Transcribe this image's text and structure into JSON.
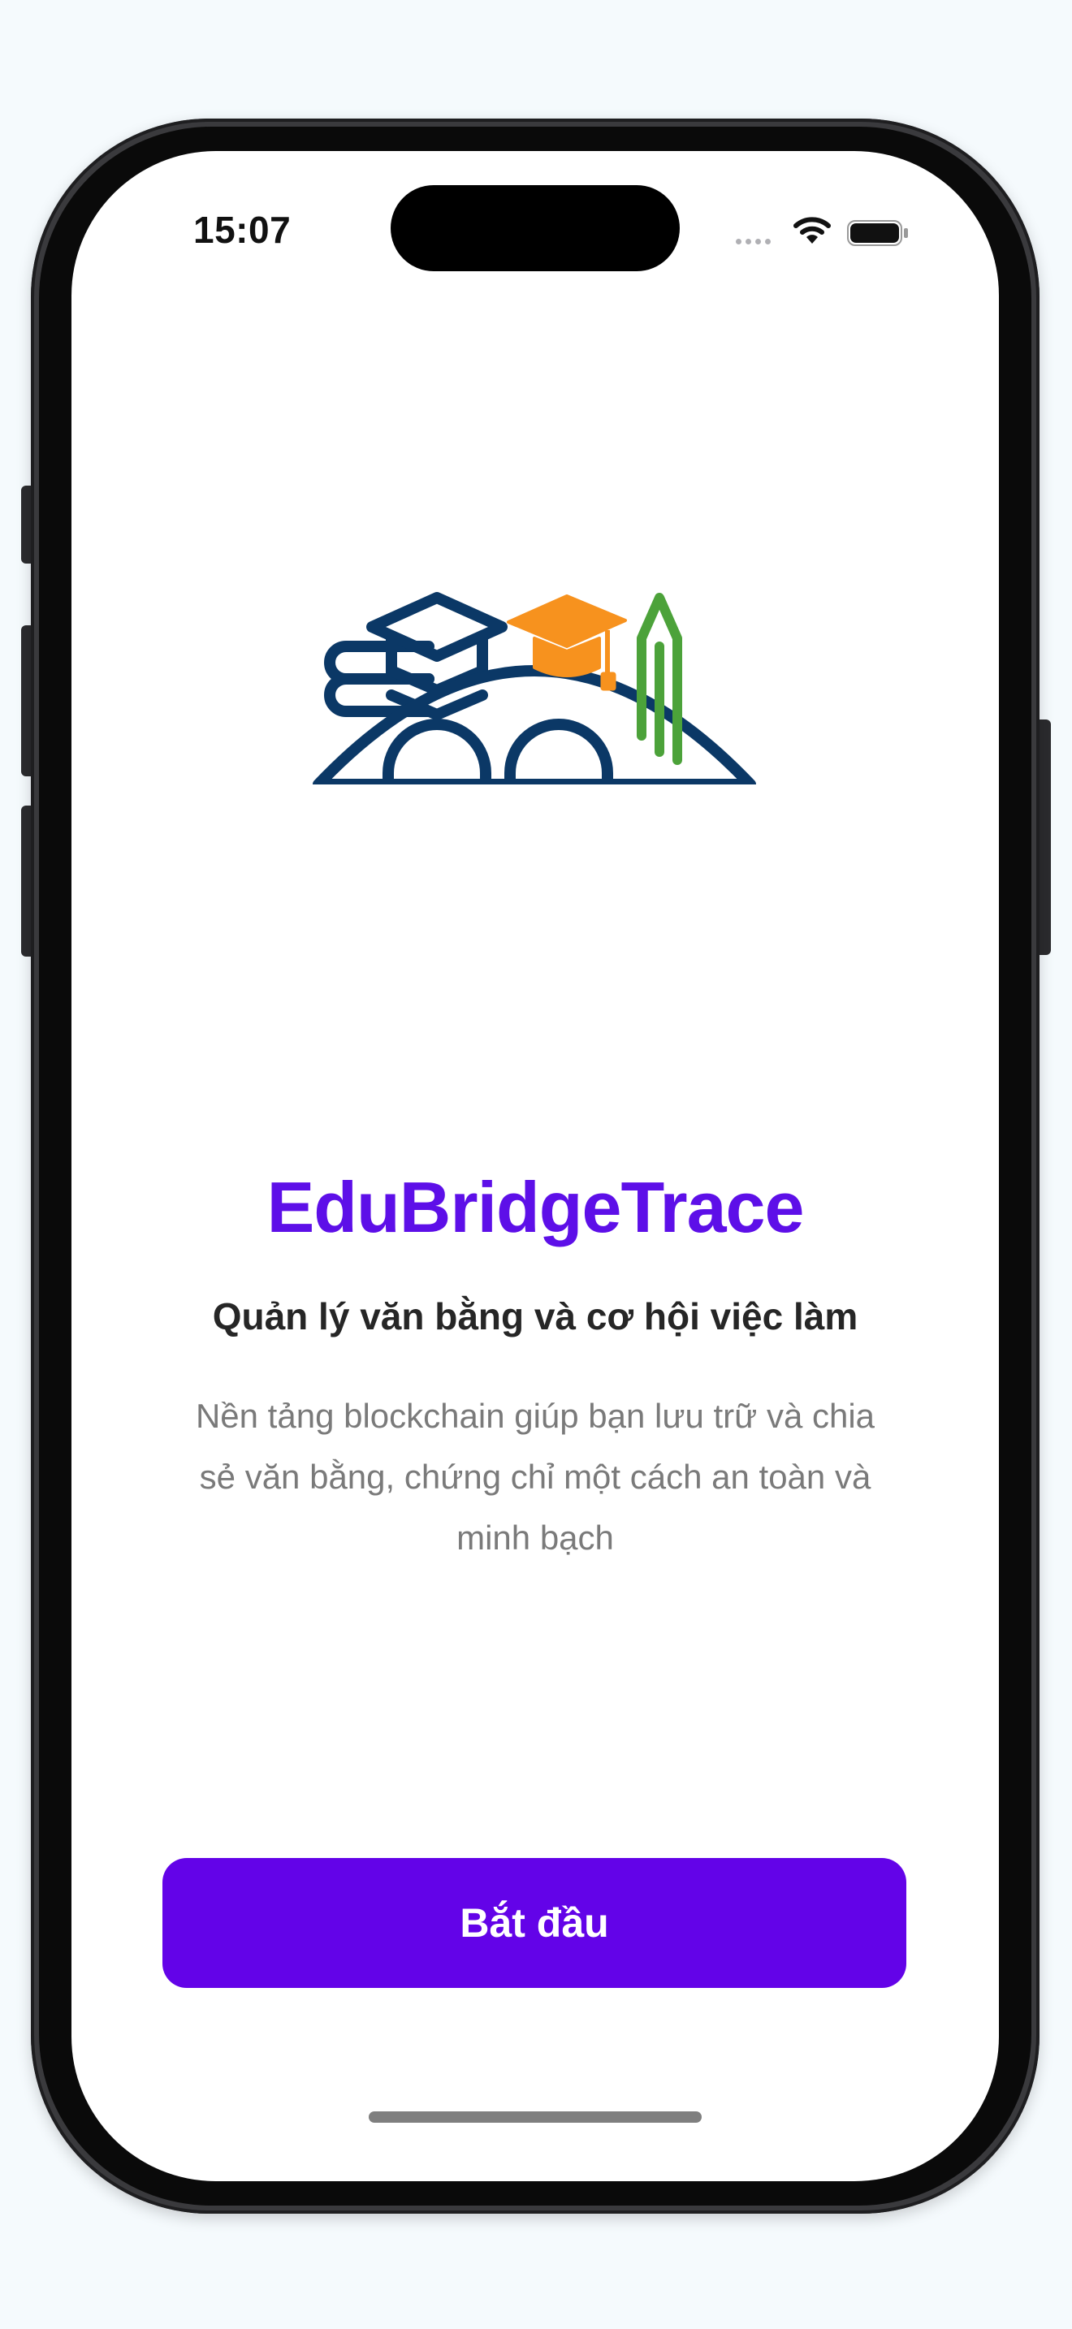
{
  "status_bar": {
    "time": "15:07",
    "icons": [
      "cellular-signal-icon",
      "wifi-icon",
      "battery-icon"
    ]
  },
  "logo": {
    "icon": "edubridge-logo-icon",
    "colors": {
      "navy": "#0b3866",
      "orange": "#f7921e",
      "green": "#4ca23a"
    }
  },
  "welcome": {
    "title": "EduBridgeTrace",
    "subtitle": "Quản lý văn bằng và cơ hội việc làm",
    "description": "Nền tảng blockchain giúp bạn lưu trữ và chia sẻ văn bằng, chứng chỉ một cách an toàn và minh bạch"
  },
  "actions": {
    "start_label": "Bắt đầu"
  },
  "colors": {
    "accent": "#6303e8",
    "title": "#5d0fe8",
    "background": "#f5fafd"
  }
}
